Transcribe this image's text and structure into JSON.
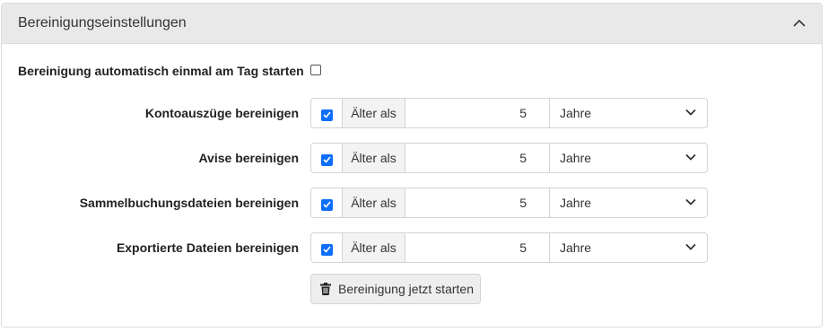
{
  "panel": {
    "title": "Bereinigungseinstellungen"
  },
  "auto": {
    "label": "Bereinigung automatisch einmal am Tag starten",
    "checked": false
  },
  "rows": [
    {
      "label": "Kontoauszüge bereinigen",
      "checked": true,
      "prefix": "Älter als",
      "value": "5",
      "unit": "Jahre"
    },
    {
      "label": "Avise bereinigen",
      "checked": true,
      "prefix": "Älter als",
      "value": "5",
      "unit": "Jahre"
    },
    {
      "label": "Sammelbuchungsdateien bereinigen",
      "checked": true,
      "prefix": "Älter als",
      "value": "5",
      "unit": "Jahre"
    },
    {
      "label": "Exportierte Dateien bereinigen",
      "checked": true,
      "prefix": "Älter als",
      "value": "5",
      "unit": "Jahre"
    }
  ],
  "action": {
    "label": "Bereinigung jetzt starten"
  },
  "colors": {
    "accent": "#0d6efd",
    "header_bg": "#e9e9e9"
  }
}
